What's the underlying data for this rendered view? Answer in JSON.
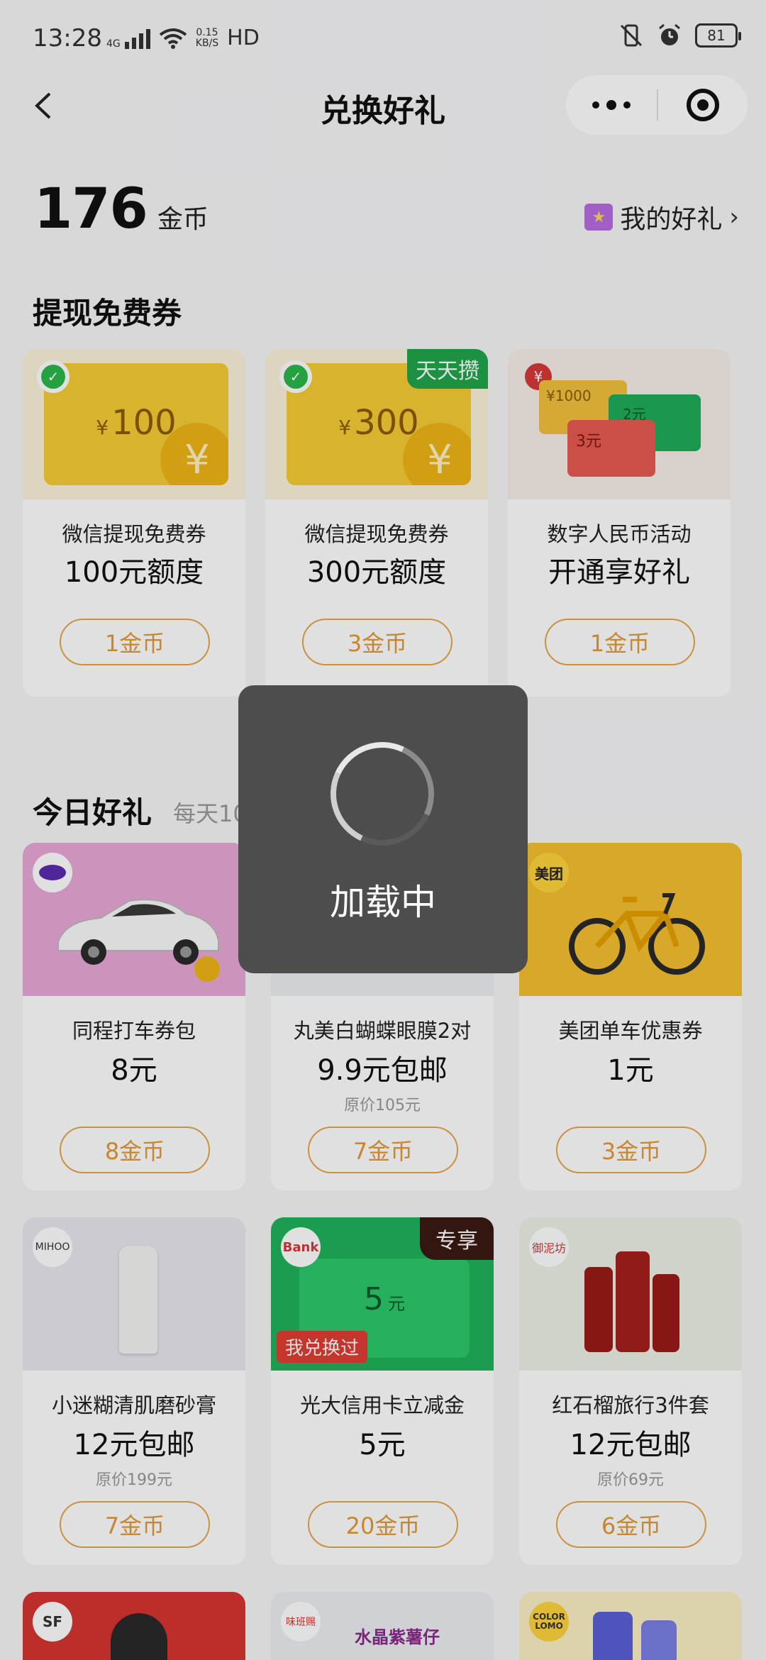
{
  "status_bar": {
    "time": "13:28",
    "network": "4G",
    "speed_value": "0.15",
    "speed_unit": "KB/S",
    "hd": "HD",
    "battery": "81"
  },
  "nav": {
    "title": "兑换好礼"
  },
  "coins": {
    "amount": "176",
    "unit": "金币",
    "my_gifts_label": "我的好礼"
  },
  "section1": {
    "title": "提现免费券",
    "cards": [
      {
        "title": "微信提现免费券",
        "value": "100元额度",
        "button": "1金币",
        "voucher_amount": "100",
        "currency": "¥"
      },
      {
        "title": "微信提现免费券",
        "value": "300元额度",
        "button": "3金币",
        "voucher_amount": "300",
        "currency": "¥",
        "tag": "天天攒"
      },
      {
        "title": "数字人民币活动",
        "value": "开通享好礼",
        "button": "1金币",
        "note1": "¥1000",
        "note2": "2元",
        "note3": "3元"
      }
    ]
  },
  "section2": {
    "title": "今日好礼",
    "subtitle": "每天10",
    "cards": [
      {
        "title": "同程打车券包",
        "value": "8元",
        "button": "8金币"
      },
      {
        "title": "丸美白蝴蝶眼膜2对",
        "value": "9.9元包邮",
        "original": "原价105元",
        "button": "7金币"
      },
      {
        "title": "美团单车优惠券",
        "value": "1元",
        "button": "3金币",
        "logo": "美团"
      },
      {
        "title": "小迷糊清肌磨砂膏",
        "value": "12元包邮",
        "original": "原价199元",
        "button": "7金币",
        "logo": "MIHOO"
      },
      {
        "title": "光大信用卡立减金",
        "value": "5元",
        "button": "20金币",
        "tag": "专享",
        "badge": "我兑换过",
        "logo": "Bank",
        "voucher_amount": "5",
        "voucher_unit": "元"
      },
      {
        "title": "红石榴旅行3件套",
        "value": "12元包邮",
        "original": "原价69元",
        "button": "6金币",
        "logo": "御泥坊"
      }
    ],
    "partial_logos": [
      "SF",
      "味班赐",
      "COLOR LOMO"
    ],
    "partial_text": "水晶紫薯仔"
  },
  "loading": {
    "text": "加载中"
  },
  "colors": {
    "accent_orange": "#e39a36",
    "wechat_green": "#2bb84a",
    "voucher_yellow": "#f6cc34",
    "toast_bg": "#4d4d4d"
  }
}
